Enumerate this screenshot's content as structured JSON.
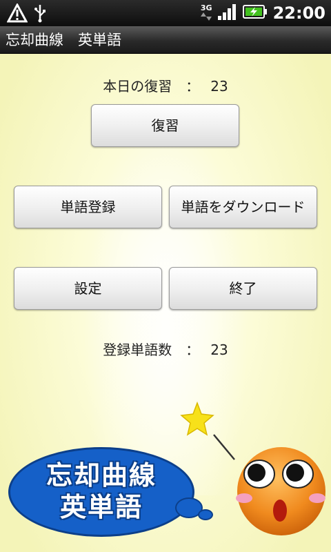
{
  "status_bar": {
    "network_type": "3G",
    "time": "22:00",
    "icons": [
      "alert-icon",
      "usb-icon",
      "network-arrows-icon",
      "signal-icon",
      "battery-charging-icon"
    ]
  },
  "title_bar": {
    "title": "忘却曲線　英単語"
  },
  "main": {
    "today_review": {
      "label": "本日の復習　：",
      "count": "23"
    },
    "review_button": "復習",
    "register_button": "単語登録",
    "download_button": "単語をダウンロード",
    "settings_button": "設定",
    "exit_button": "終了",
    "registered_words": {
      "label": "登録単語数　：",
      "count": "23"
    }
  },
  "logo": {
    "line1": "忘却曲線",
    "line2": "英単語"
  },
  "colors": {
    "background": "#f6f6c0",
    "logo_blue": "#1560c8",
    "mascot_orange": "#f08a1e",
    "star": "#f7e11a"
  }
}
